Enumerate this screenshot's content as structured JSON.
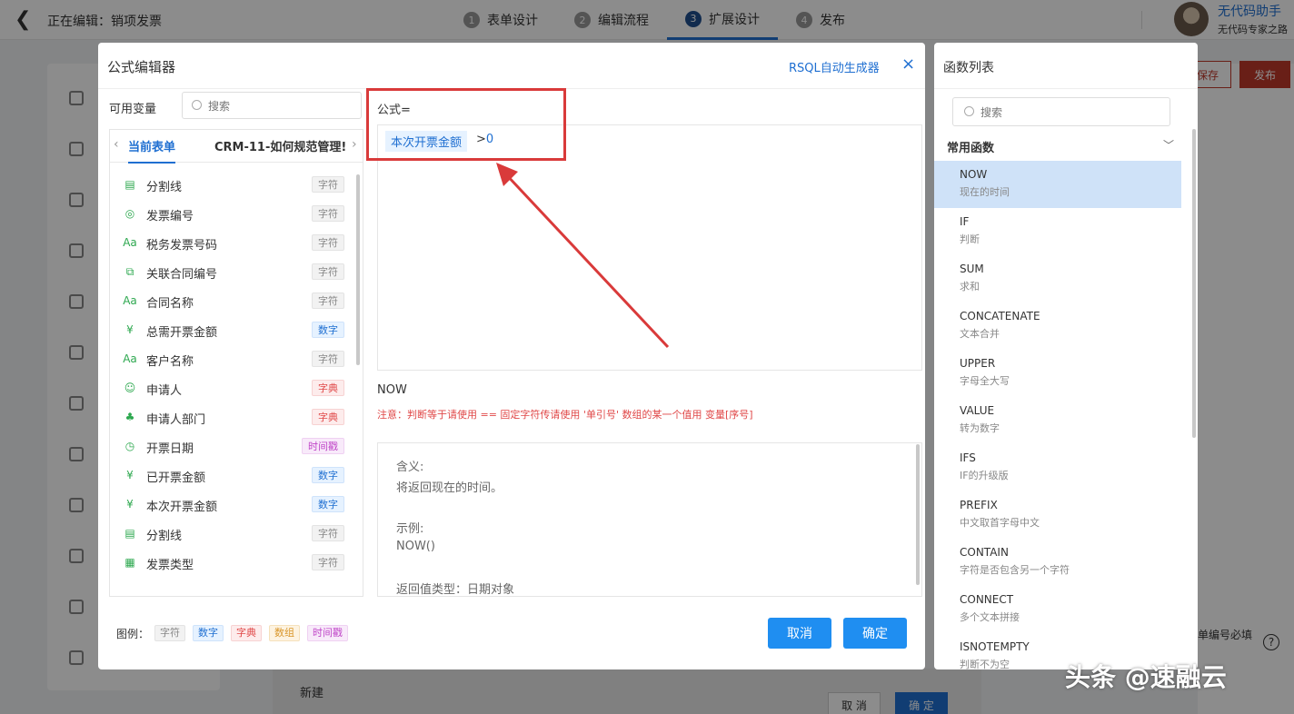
{
  "app": {
    "editing_title": "正在编辑：销项发票",
    "steps": [
      {
        "num": "1",
        "label": "表单设计"
      },
      {
        "num": "2",
        "label": "编辑流程"
      },
      {
        "num": "3",
        "label": "扩展设计"
      },
      {
        "num": "4",
        "label": "发布"
      }
    ],
    "user_name": "无代码助手",
    "user_sub": "无代码专家之路",
    "save_label": "保存",
    "publish_label": "发布",
    "bg_hint": "单编号必填",
    "help_label": "?",
    "new_label": "新建",
    "bg_cancel": "取 消",
    "bg_ok": "确 定"
  },
  "modal": {
    "title": "公式编辑器",
    "rsql_link": "RSQL自动生成器",
    "close": "×",
    "vars_label": "可用变量",
    "search_placeholder": "搜索",
    "tab_current": "当前表单",
    "tab_other": "CRM-11-如何规范管理!",
    "variables": [
      {
        "icon": "divider-icon",
        "glyph": "▤",
        "name": "分割线",
        "tag": "字符",
        "type": "str"
      },
      {
        "icon": "serial-icon",
        "glyph": "◎",
        "name": "发票编号",
        "tag": "字符",
        "type": "str"
      },
      {
        "icon": "text-icon",
        "glyph": "Aa",
        "name": "税务发票号码",
        "tag": "字符",
        "type": "str"
      },
      {
        "icon": "link-icon",
        "glyph": "⧉",
        "name": "关联合同编号",
        "tag": "字符",
        "type": "str"
      },
      {
        "icon": "text-icon",
        "glyph": "Aa",
        "name": "合同名称",
        "tag": "字符",
        "type": "str"
      },
      {
        "icon": "yuan-icon",
        "glyph": "¥",
        "name": "总需开票金额",
        "tag": "数字",
        "type": "num"
      },
      {
        "icon": "text-icon",
        "glyph": "Aa",
        "name": "客户名称",
        "tag": "字符",
        "type": "str"
      },
      {
        "icon": "users-icon",
        "glyph": "☺",
        "name": "申请人",
        "tag": "字典",
        "type": "dict"
      },
      {
        "icon": "org-icon",
        "glyph": "♣",
        "name": "申请人部门",
        "tag": "字典",
        "type": "dict"
      },
      {
        "icon": "clock-icon",
        "glyph": "◷",
        "name": "开票日期",
        "tag": "时间戳",
        "type": "ts"
      },
      {
        "icon": "yuan-icon",
        "glyph": "¥",
        "name": "已开票金额",
        "tag": "数字",
        "type": "num"
      },
      {
        "icon": "yuan-icon",
        "glyph": "¥",
        "name": "本次开票金额",
        "tag": "数字",
        "type": "num"
      },
      {
        "icon": "divider-icon",
        "glyph": "▤",
        "name": "分割线",
        "tag": "字符",
        "type": "str"
      },
      {
        "icon": "select-icon",
        "glyph": "▦",
        "name": "发票类型",
        "tag": "字符",
        "type": "str"
      }
    ],
    "legend_label": "图例：",
    "legend": [
      {
        "label": "字符",
        "type": "str"
      },
      {
        "label": "数字",
        "type": "num"
      },
      {
        "label": "字典",
        "type": "dict"
      },
      {
        "label": "数组",
        "type": "arr"
      },
      {
        "label": "时间戳",
        "type": "ts"
      }
    ],
    "formula_label": "公式=",
    "formula_chip": "本次开票金额",
    "formula_op": ">",
    "formula_value": "0",
    "function_name": "NOW",
    "notice": "注意：判断等于请使用 == 固定字符传请使用 '单引号' 数组的某一个值用 变量[序号]",
    "desc": {
      "meaning_label": "含义:",
      "meaning": "将返回现在的时间。",
      "example_label": "示例:",
      "example": "NOW()",
      "return_type": "返回值类型：日期对象"
    },
    "cancel": "取消",
    "ok": "确定"
  },
  "functions": {
    "title": "函数列表",
    "search_placeholder": "搜索",
    "group": "常用函数",
    "items": [
      {
        "name": "NOW",
        "desc": "现在的时间",
        "selected": true
      },
      {
        "name": "IF",
        "desc": "判断"
      },
      {
        "name": "SUM",
        "desc": "求和"
      },
      {
        "name": "CONCATENATE",
        "desc": "文本合并"
      },
      {
        "name": "UPPER",
        "desc": "字母全大写"
      },
      {
        "name": "VALUE",
        "desc": "转为数字"
      },
      {
        "name": "IFS",
        "desc": "IF的升级版"
      },
      {
        "name": "PREFIX",
        "desc": "中文取首字母中文"
      },
      {
        "name": "CONTAIN",
        "desc": "字符是否包含另一个字符"
      },
      {
        "name": "CONNECT",
        "desc": "多个文本拼接"
      },
      {
        "name": "ISNOTEMPTY",
        "desc": "判断不为空"
      }
    ]
  },
  "watermark": "头条 @速融云"
}
